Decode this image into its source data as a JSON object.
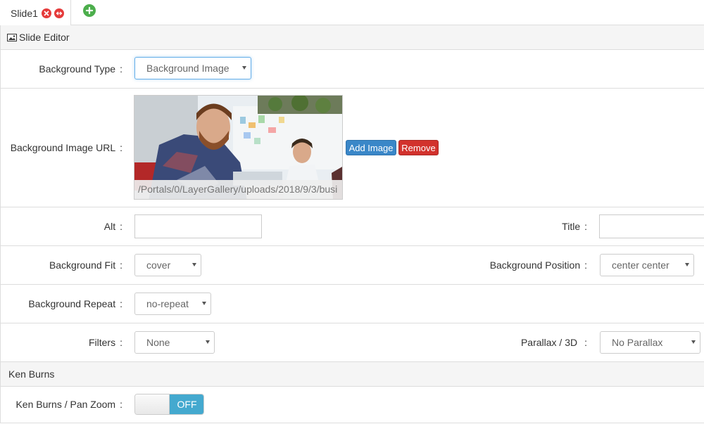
{
  "tabs": {
    "items": [
      {
        "label": "Slide1",
        "close_icon": "close-icon",
        "move_icon": "move-icon"
      }
    ],
    "add_icon": "plus-icon",
    "colors": {
      "close": "#e53b3b",
      "add": "#4cae4c"
    }
  },
  "slide_editor": {
    "header": "Slide Editor",
    "header_icon": "image-icon",
    "background_type": {
      "label": "Background Type",
      "value": "Background Image"
    },
    "background_image_url": {
      "label": "Background Image URL",
      "url": "/Portals/0/LayerGallery/uploads/2018/9/3/busi",
      "add_label": "Add Image",
      "remove_label": "Remove"
    },
    "alt": {
      "label": "Alt",
      "value": ""
    },
    "title": {
      "label": "Title",
      "value": ""
    },
    "background_fit": {
      "label": "Background Fit",
      "value": "cover"
    },
    "background_position": {
      "label": "Background Position",
      "value": "center center"
    },
    "background_repeat": {
      "label": "Background Repeat",
      "value": "no-repeat"
    },
    "filters": {
      "label": "Filters",
      "value": "None"
    },
    "parallax": {
      "label": "Parallax / 3D",
      "value": "No Parallax"
    }
  },
  "ken_burns": {
    "header": "Ken Burns",
    "pan_zoom": {
      "label": "Ken Burns / Pan Zoom",
      "state": "OFF"
    }
  },
  "colors": {
    "accent": "#3a87c8",
    "danger": "#d2322d",
    "toggle": "#44a9cf"
  },
  "colon": ":"
}
